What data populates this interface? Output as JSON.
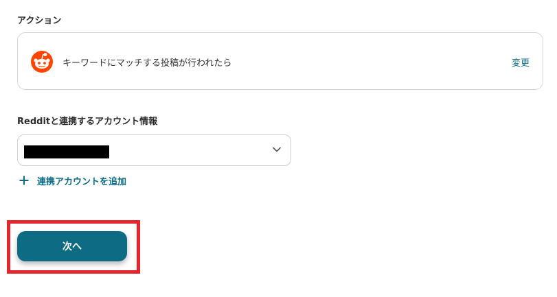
{
  "action_section": {
    "label": "アクション",
    "icon": "reddit-icon",
    "action_text": "キーワードにマッチする投稿が行われたら",
    "change_label": "変更"
  },
  "account_section": {
    "label": "Redditと連携するアカウント情報",
    "selected_value_redacted": true,
    "add_account_label": "連携アカウントを追加"
  },
  "next_button": {
    "label": "次へ"
  },
  "colors": {
    "accent": "#0e6b84",
    "link": "#0d6b86",
    "reddit_orange": "#ff4500",
    "highlight": "#e5242c"
  }
}
